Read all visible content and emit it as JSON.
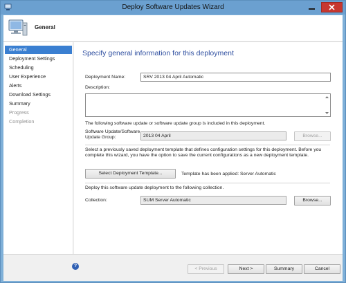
{
  "window": {
    "title": "Deploy Software Updates Wizard"
  },
  "header": {
    "title": "General",
    "icon": "computer-monitor-icon"
  },
  "nav": {
    "items": [
      {
        "label": "General",
        "state": "active"
      },
      {
        "label": "Deployment Settings",
        "state": "enabled"
      },
      {
        "label": "Scheduling",
        "state": "enabled"
      },
      {
        "label": "User Experience",
        "state": "enabled"
      },
      {
        "label": "Alerts",
        "state": "enabled"
      },
      {
        "label": "Download Settings",
        "state": "enabled"
      },
      {
        "label": "Summary",
        "state": "enabled"
      },
      {
        "label": "Progress",
        "state": "disabled"
      },
      {
        "label": "Completion",
        "state": "disabled"
      }
    ]
  },
  "main": {
    "heading": "Specify general information for this deployment",
    "deployment_name_label": "Deployment Name:",
    "deployment_name_value": "SRV 2013 04 April Automatic",
    "description_label": "Description:",
    "description_value": "",
    "update_group_info": "The following software update or software update group is included in this deployment.",
    "update_group_label": "Software Update/Software Update Group:",
    "update_group_value": "2013 04 April",
    "browse_update_label": "Browse...",
    "template_info": "Select a previously saved deployment template that defines configuration settings for this deployment. Before you complete this wizard, you have the option to save the current configurations as a new deployment template.",
    "select_template_label": "Select Deployment Template...",
    "template_applied_text": "Template has been applied: Server Automatic",
    "collection_info": "Deploy this software update deployment to the following collection.",
    "collection_label": "Collection:",
    "collection_value": "SUM Server Automatic",
    "browse_collection_label": "Browse..."
  },
  "footer": {
    "previous_label": "< Previous",
    "next_label": "Next >",
    "summary_label": "Summary",
    "cancel_label": "Cancel",
    "help_glyph": "?"
  },
  "colors": {
    "title_bar": "#6ba0d0",
    "nav_active": "#3a7fd1",
    "heading": "#2f4fa0",
    "close_button": "#c7372f"
  }
}
